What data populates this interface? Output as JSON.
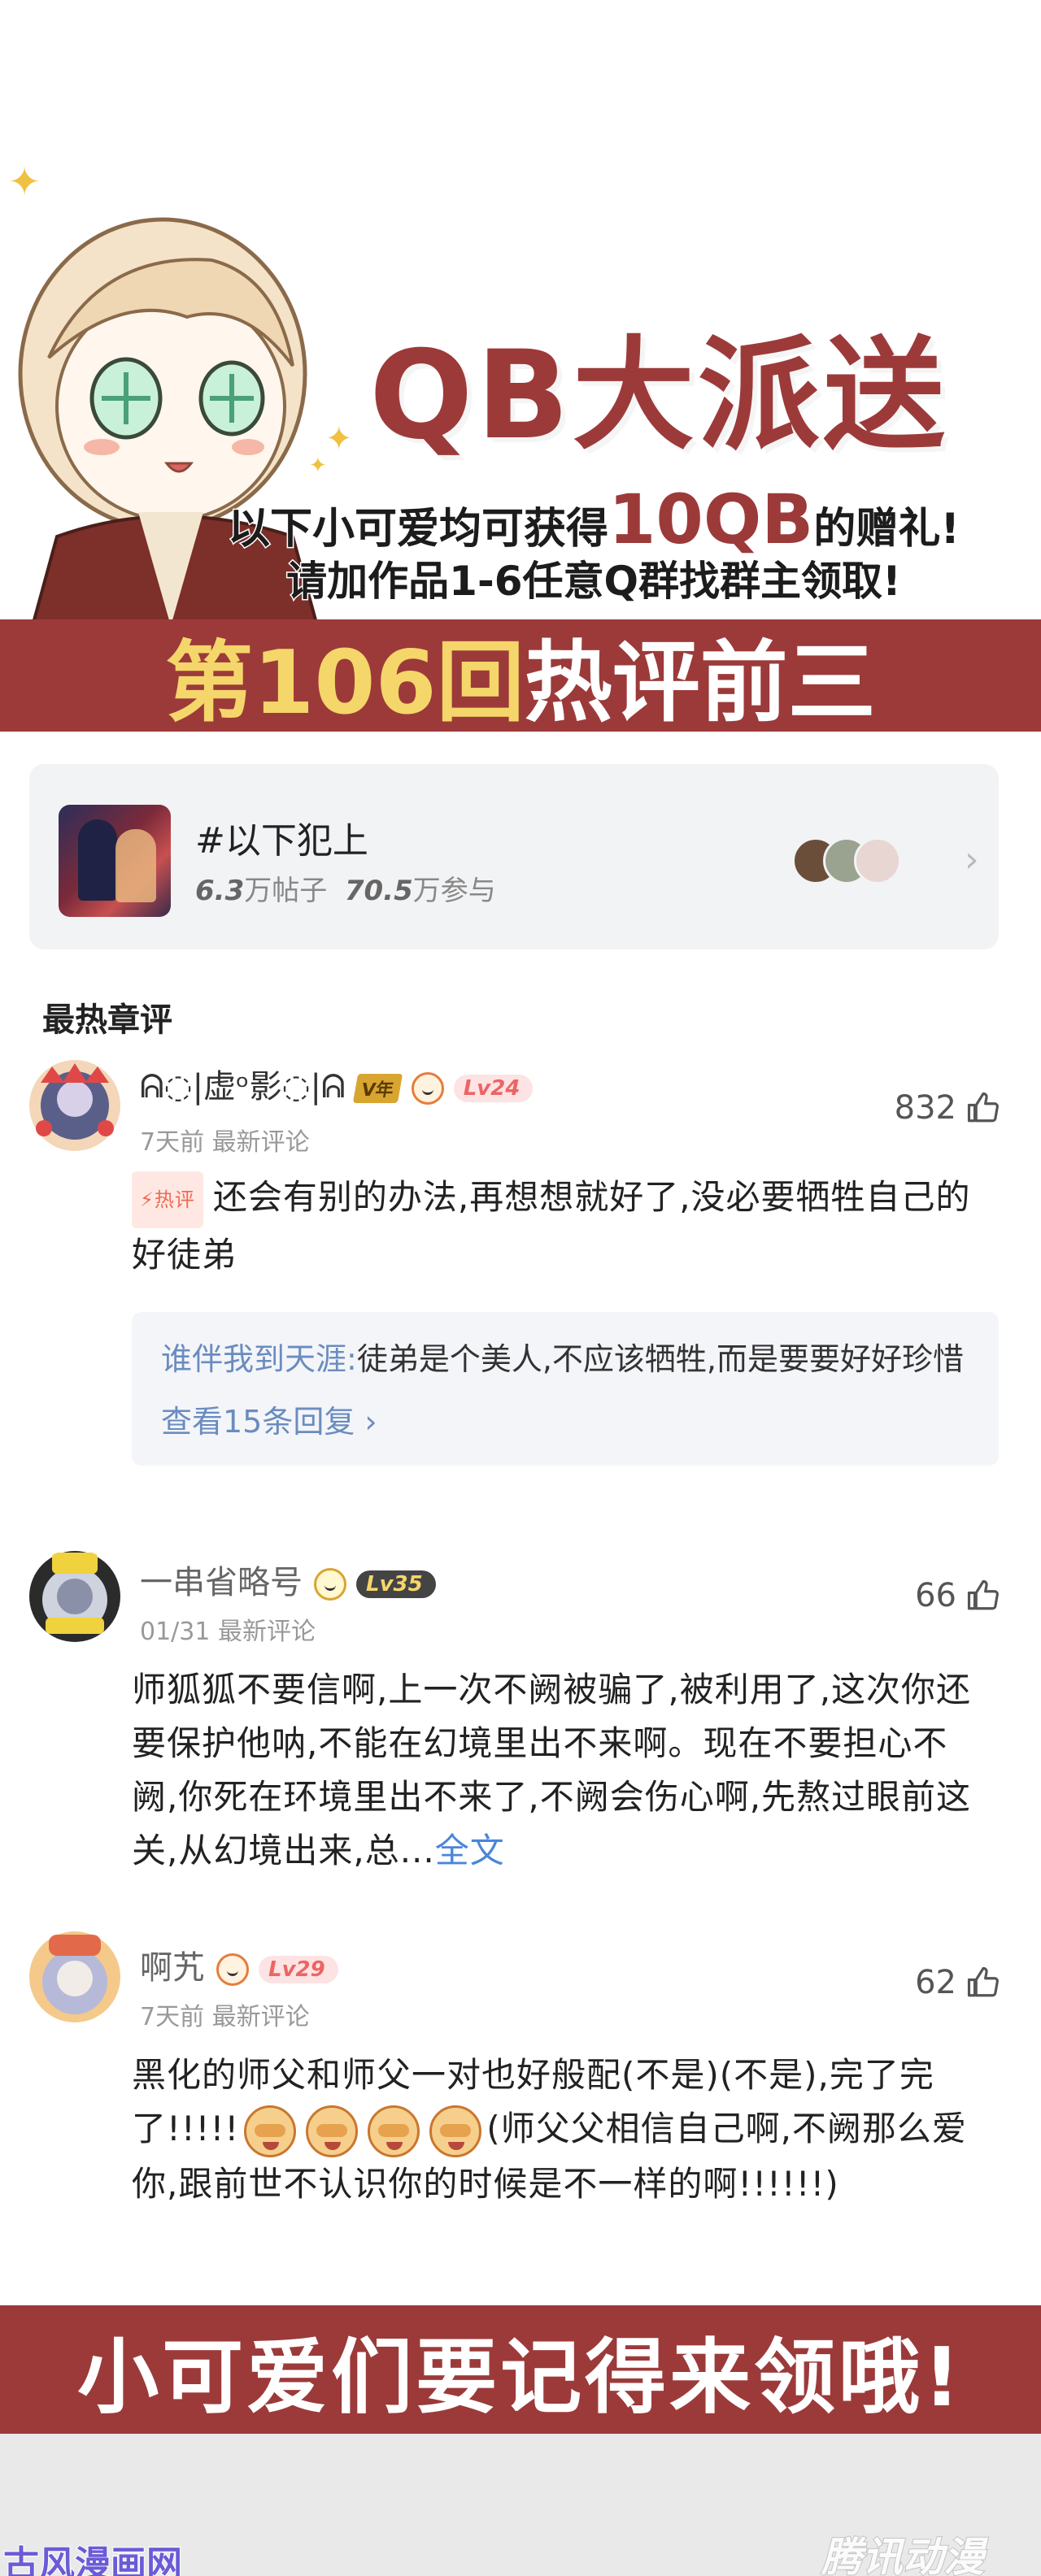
{
  "banner": {
    "title": "QB大派送",
    "line1_prefix": "以下小可爱均可获得",
    "line1_amount": "10QB",
    "line1_suffix": "的赠礼!",
    "line2": "请加作品1-6任意Q群找群主领取!",
    "band_highlight": "第106回",
    "band_rest": "热评前三",
    "colors": {
      "brand_red": "#9c3a3a",
      "band_yellow": "#f5d66a"
    }
  },
  "topic": {
    "name": "#以下犯上",
    "posts_value": "6.3",
    "posts_label": "万帖子",
    "participants_value": "70.5",
    "participants_label": "万参与",
    "chevron_icon": "chevron-right-icon"
  },
  "section_title": "最热章评",
  "comments": [
    {
      "name": "ᕱ◌|虚ᵒ影◌|ᕱ",
      "vip_badge": "V年",
      "level": "Lv24",
      "time": "7天前",
      "tag": "最新评论",
      "likes": "832",
      "hot_tag": "⚡热评",
      "text": "还会有别的办法,再想想就好了,没必要牺牲自己的好徒弟",
      "reply": {
        "user": "谁伴我到天涯:",
        "text": "徒弟是个美人,不应该牺牲,而是要要好好珍惜",
        "more": "查看15条回复 ›"
      }
    },
    {
      "name": "一串省略号",
      "level": "Lv35",
      "time": "01/31",
      "tag": "最新评论",
      "likes": "66",
      "text": "师狐狐不要信啊,上一次不阙被骗了,被利用了,这次你还要保护他呐,不能在幻境里出不来啊。现在不要担心不阙,你死在环境里出不来了,不阙会伤心啊,先熬过眼前这关,从幻境出来,总...",
      "more": "全文"
    },
    {
      "name": "啊艽",
      "level": "Lv29",
      "time": "7天前",
      "tag": "最新评论",
      "likes": "62",
      "text_a": "黑化的师父和师父一对也好般配(不是)(不是),完了完了!!!!!",
      "text_b": "(师父父相信自己啊,不阙那么爱你,跟前世不认识你的时候是不一样的啊!!!!!!)"
    }
  ],
  "bottom_band": "小可爱们要记得来领哦!",
  "watermark_left": "古风漫画网",
  "watermark_right": "腾讯动漫"
}
